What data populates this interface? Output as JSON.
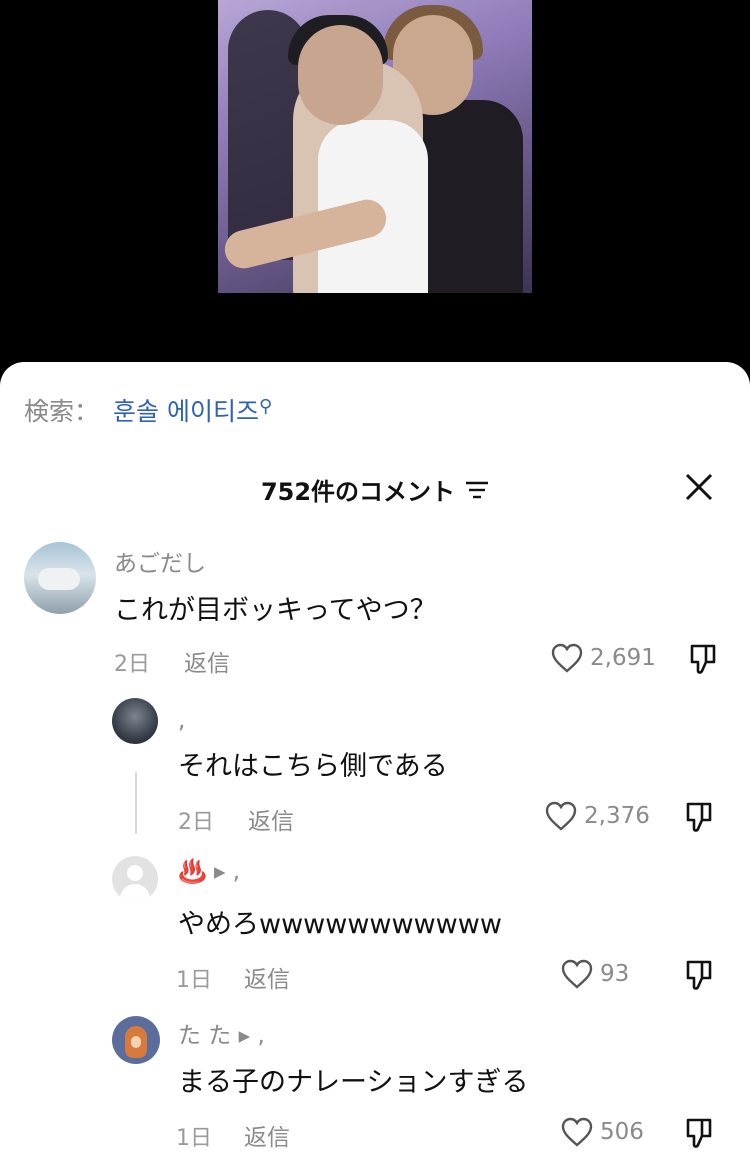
{
  "video": {
    "description_icon": "video-thumbnail"
  },
  "search": {
    "label": "検索：",
    "term": "훈솔 에이티즈"
  },
  "header": {
    "title": "752件のコメント"
  },
  "comments": [
    {
      "user": "あごだし",
      "text": "これが目ボッキってやつ？",
      "date": "2日",
      "reply": "返信",
      "likes": "2,691"
    },
    {
      "user": ",",
      "text": "それはこちら側である",
      "date": "2日",
      "reply": "返信",
      "likes": "2,376"
    },
    {
      "user_icon": "♨️",
      "user": "▸ ,",
      "text": "やめろwwwwwwwwwww",
      "date": "1日",
      "reply": "返信",
      "likes": "93"
    },
    {
      "user": "た た ▸ ,",
      "text": "まる子のナレーションすぎる",
      "date": "1日",
      "reply": "返信",
      "likes": "506"
    }
  ],
  "colors": {
    "link": "#2f62b6",
    "muted": "#8a8a8a",
    "text": "#111111"
  }
}
